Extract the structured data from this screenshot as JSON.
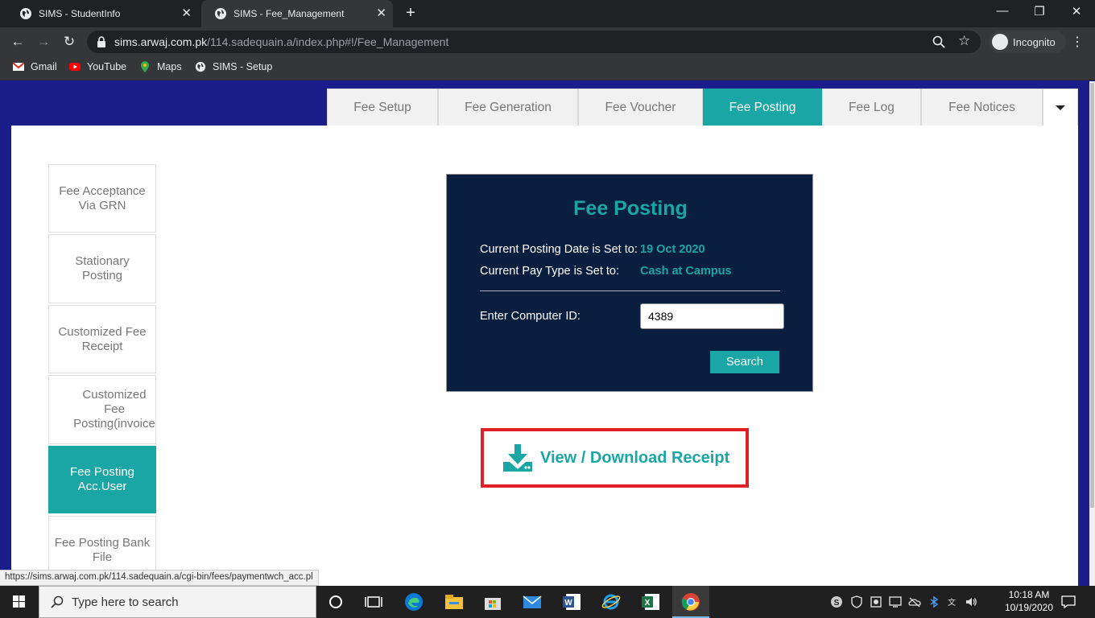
{
  "browser": {
    "tabs": [
      {
        "title": "SIMS - StudentInfo"
      },
      {
        "title": "SIMS - Fee_Management"
      }
    ],
    "new_tab": "+",
    "window_controls": {
      "minimize": "—",
      "restore": "❐",
      "close": "✕"
    },
    "url_host": "sims.arwaj.com.pk",
    "url_path": "/114.sadequain.a/index.php#!/Fee_Management",
    "incognito_label": "Incognito",
    "bookmarks": [
      {
        "label": "Gmail",
        "icon": "gmail-icon"
      },
      {
        "label": "YouTube",
        "icon": "youtube-icon"
      },
      {
        "label": "Maps",
        "icon": "maps-icon"
      },
      {
        "label": "SIMS - Setup",
        "icon": "globe-icon"
      }
    ]
  },
  "top_nav": {
    "tabs": [
      "Fee Setup",
      "Fee Generation",
      "Fee Voucher",
      "Fee Posting",
      "Fee Log",
      "Fee Notices"
    ],
    "active": "Fee Posting"
  },
  "sidebar": {
    "items": [
      "Fee Acceptance Via GRN",
      "Stationary Posting",
      "Customized Fee Receipt",
      "Customized Fee Posting(invoice",
      "Fee Posting Acc.User",
      "Fee Posting Bank File"
    ],
    "active": "Fee Posting Acc.User"
  },
  "panel": {
    "title": "Fee Posting",
    "posting_date_label": "Current Posting Date is Set to:",
    "posting_date_value": "19 Oct 2020",
    "pay_type_label": "Current Pay Type is Set to:",
    "pay_type_value": "Cash at Campus",
    "computer_id_label": "Enter Computer ID:",
    "computer_id_value": "4389",
    "search_label": "Search"
  },
  "receipt": {
    "label": "View / Download Receipt"
  },
  "status_link": "https://sims.arwaj.com.pk/114.sadequain.a/cgi-bin/fees/paymentwch_acc.pl",
  "taskbar": {
    "search_placeholder": "Type here to search",
    "time": "10:18 AM",
    "date": "10/19/2020"
  },
  "colors": {
    "accent": "#1aa6a5",
    "page_bg": "#1b1d8a",
    "panel_bg": "#0a1e3f",
    "highlight_border": "#e02026"
  }
}
